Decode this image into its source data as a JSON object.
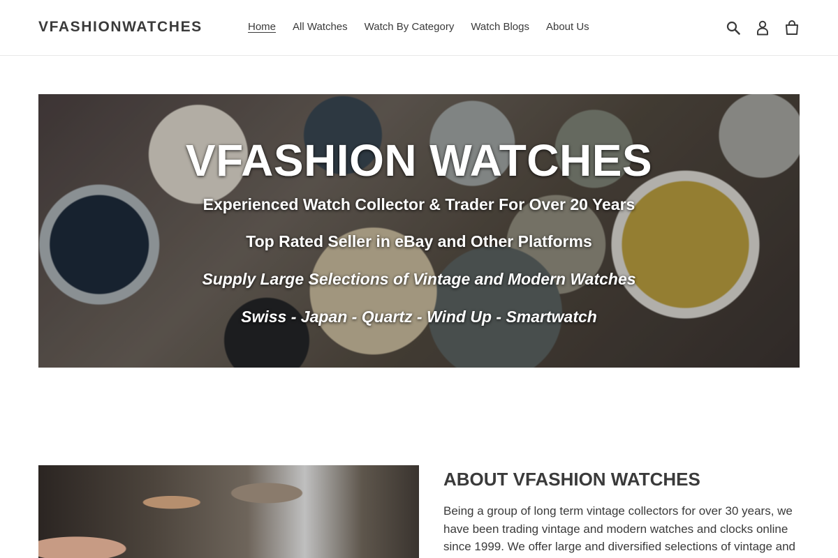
{
  "header": {
    "logo": "VFASHIONWATCHES",
    "nav": [
      {
        "label": "Home",
        "active": true
      },
      {
        "label": "All Watches",
        "active": false
      },
      {
        "label": "Watch By Category",
        "active": false
      },
      {
        "label": "Watch Blogs",
        "active": false
      },
      {
        "label": "About Us",
        "active": false
      }
    ],
    "icons": [
      "search-icon",
      "account-icon",
      "cart-icon"
    ]
  },
  "hero": {
    "title": "VFASHION WATCHES",
    "lines": [
      "Experienced Watch Collector & Trader For Over 20 Years",
      "Top Rated Seller in eBay and Other Platforms",
      "Supply Large Selections of Vintage and Modern Watches",
      "Swiss - Japan - Quartz - Wind Up - Smartwatch"
    ]
  },
  "about": {
    "title": "ABOUT VFASHION WATCHES",
    "text": "Being a group of long term vintage collectors for over 30 years, we have been trading vintage and modern watches and clocks online since 1999. We offer large and diversified selections of vintage and"
  },
  "colors": {
    "text": "#3a3a3a",
    "border": "#e8e8e8",
    "hero_text": "#ffffff"
  }
}
